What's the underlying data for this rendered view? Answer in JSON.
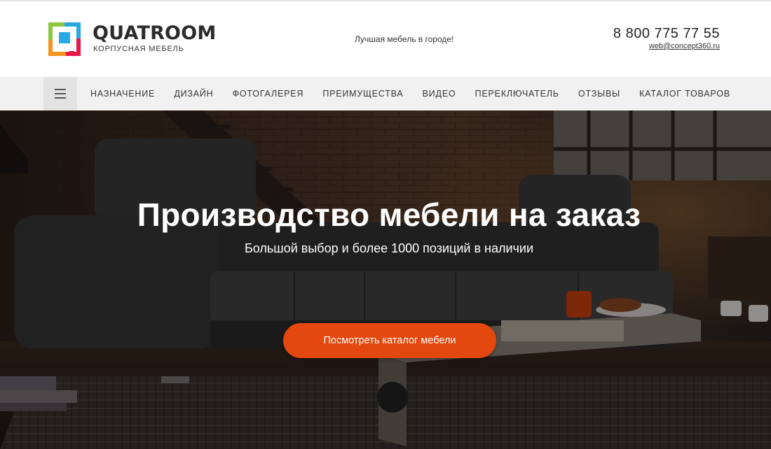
{
  "header": {
    "logo": {
      "name": "QUATROOM",
      "subtitle": "КОРПУСНАЯ МЕБЕЛЬ"
    },
    "tagline": "Лучшая мебель в городе!",
    "phone": "8 800 775 77 55",
    "email": "web@concept360.ru"
  },
  "nav": {
    "items": [
      {
        "label": "НАЗНАЧЕНИЕ"
      },
      {
        "label": "ДИЗАЙН"
      },
      {
        "label": "ФОТОГАЛЕРЕЯ"
      },
      {
        "label": "ПРЕИМУЩЕСТВА"
      },
      {
        "label": "ВИДЕО"
      },
      {
        "label": "ПЕРЕКЛЮЧАТЕЛЬ"
      },
      {
        "label": "ОТЗЫВЫ"
      },
      {
        "label": "КАТАЛОГ ТОВАРОВ"
      }
    ]
  },
  "hero": {
    "title": "Производство мебели на заказ",
    "subtitle": "Большой выбор и более 1000 позиций в наличии",
    "cta_label": "Посмотреть каталог мебели"
  },
  "colors": {
    "accent": "#e4480e",
    "nav_bg": "#f1f1f1",
    "logo_green": "#8dc63f",
    "logo_orange": "#f7941d",
    "logo_blue": "#27aae1",
    "logo_red": "#e5194a"
  }
}
